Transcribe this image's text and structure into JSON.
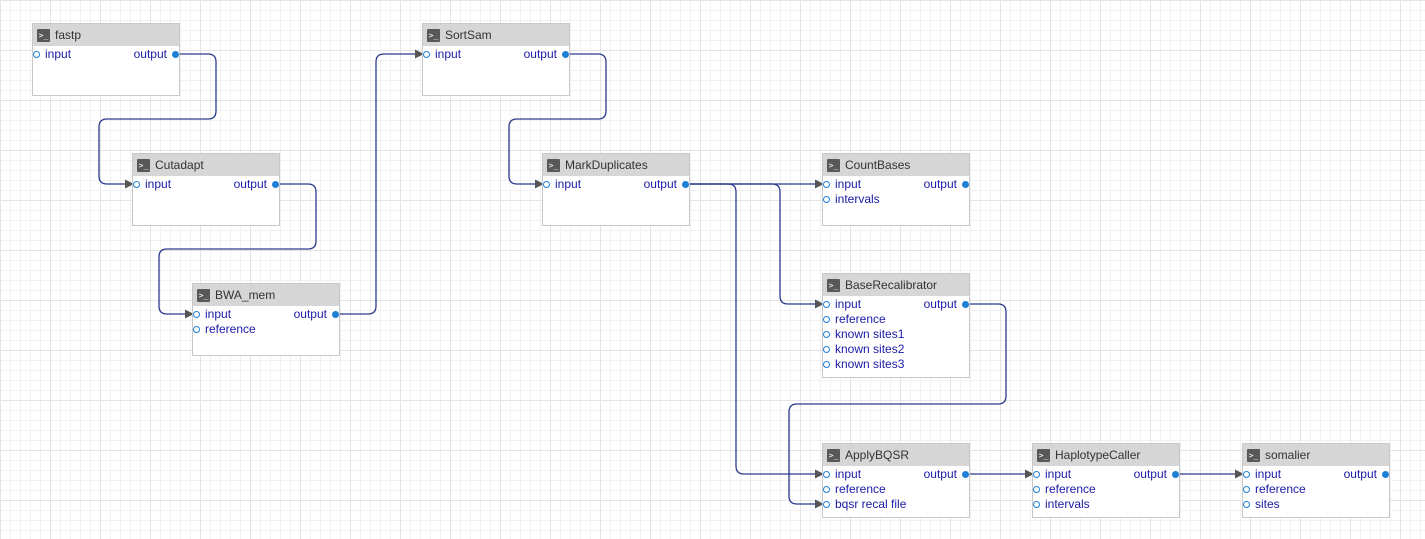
{
  "nodes": [
    {
      "id": "fastp",
      "title": "fastp",
      "icon": "terminal-icon",
      "inputs": [
        "input"
      ],
      "outputs": [
        "output"
      ]
    },
    {
      "id": "cutadapt",
      "title": "Cutadapt",
      "icon": "terminal-icon",
      "inputs": [
        "input"
      ],
      "outputs": [
        "output"
      ]
    },
    {
      "id": "bwa_mem",
      "title": "BWA_mem",
      "icon": "terminal-icon",
      "inputs": [
        "input",
        "reference"
      ],
      "outputs": [
        "output"
      ]
    },
    {
      "id": "sortsam",
      "title": "SortSam",
      "icon": "terminal-icon",
      "inputs": [
        "input"
      ],
      "outputs": [
        "output"
      ]
    },
    {
      "id": "markduplicates",
      "title": "MarkDuplicates",
      "icon": "terminal-icon",
      "inputs": [
        "input"
      ],
      "outputs": [
        "output"
      ]
    },
    {
      "id": "countbases",
      "title": "CountBases",
      "icon": "terminal-icon",
      "inputs": [
        "input",
        "intervals"
      ],
      "outputs": [
        "output"
      ]
    },
    {
      "id": "baserecalibrator",
      "title": "BaseRecalibrator",
      "icon": "terminal-icon",
      "inputs": [
        "input",
        "reference",
        "known sites1",
        "known sites2",
        "known sites3"
      ],
      "outputs": [
        "output"
      ]
    },
    {
      "id": "applybqsr",
      "title": "ApplyBQSR",
      "icon": "terminal-icon",
      "inputs": [
        "input",
        "reference",
        "bqsr recal file"
      ],
      "outputs": [
        "output"
      ]
    },
    {
      "id": "haplotypecaller",
      "title": "HaplotypeCaller",
      "icon": "terminal-icon",
      "inputs": [
        "input",
        "reference",
        "intervals"
      ],
      "outputs": [
        "output"
      ]
    },
    {
      "id": "somalier",
      "title": "somalier",
      "icon": "terminal-icon",
      "inputs": [
        "input",
        "reference",
        "sites"
      ],
      "outputs": [
        "output"
      ]
    }
  ],
  "edges": [
    {
      "from": "fastp",
      "to": "cutadapt",
      "to_port": 0
    },
    {
      "from": "cutadapt",
      "to": "bwa_mem",
      "to_port": 0
    },
    {
      "from": "bwa_mem",
      "to": "sortsam",
      "to_port": 0
    },
    {
      "from": "sortsam",
      "to": "markduplicates",
      "to_port": 0
    },
    {
      "from": "markduplicates",
      "to": "countbases",
      "to_port": 0
    },
    {
      "from": "markduplicates",
      "to": "baserecalibrator",
      "to_port": 0
    },
    {
      "from": "markduplicates",
      "to": "applybqsr",
      "to_port": 0
    },
    {
      "from": "baserecalibrator",
      "to": "applybqsr",
      "to_port": 2
    },
    {
      "from": "applybqsr",
      "to": "haplotypecaller",
      "to_port": 0
    },
    {
      "from": "haplotypecaller",
      "to": "somalier",
      "to_port": 0
    }
  ],
  "colors": {
    "wire": "#2b3a8c",
    "port_label": "#1a1aa6",
    "port_dot": "#1e7fd6",
    "header": "#d6d6d6"
  }
}
